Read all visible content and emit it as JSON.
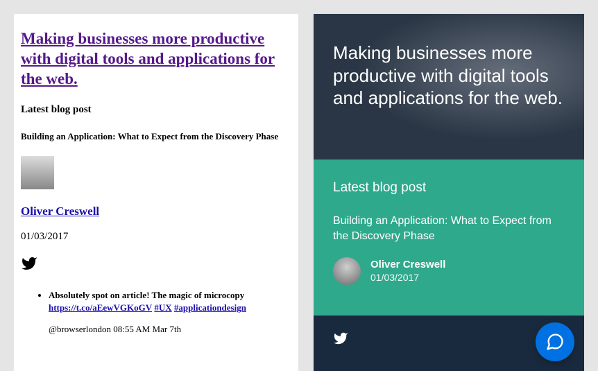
{
  "left": {
    "hero": "Making businesses more productive with digital tools and applications for the web.",
    "latest_label": "Latest blog post",
    "post_title": "Building an Application: What to Expect from the Discovery Phase",
    "author": "Oliver Creswell",
    "date": "01/03/2017",
    "tweet_text": "Absolutely spot on article! The magic of microcopy",
    "tweet_link": "https://t.co/aEewVGKoGV",
    "tweet_hash1": "#UX",
    "tweet_hash2": "#applicationdesign",
    "tweet_meta": "@browserlondon 08:55 AM Mar 7th"
  },
  "right": {
    "hero": "Making businesses more productive with digital tools and applications for the web.",
    "latest_label": "Latest blog post",
    "post_title": "Building an Application: What to Expect from the Discovery Phase",
    "author": "Oliver Creswell",
    "date": "01/03/2017"
  }
}
